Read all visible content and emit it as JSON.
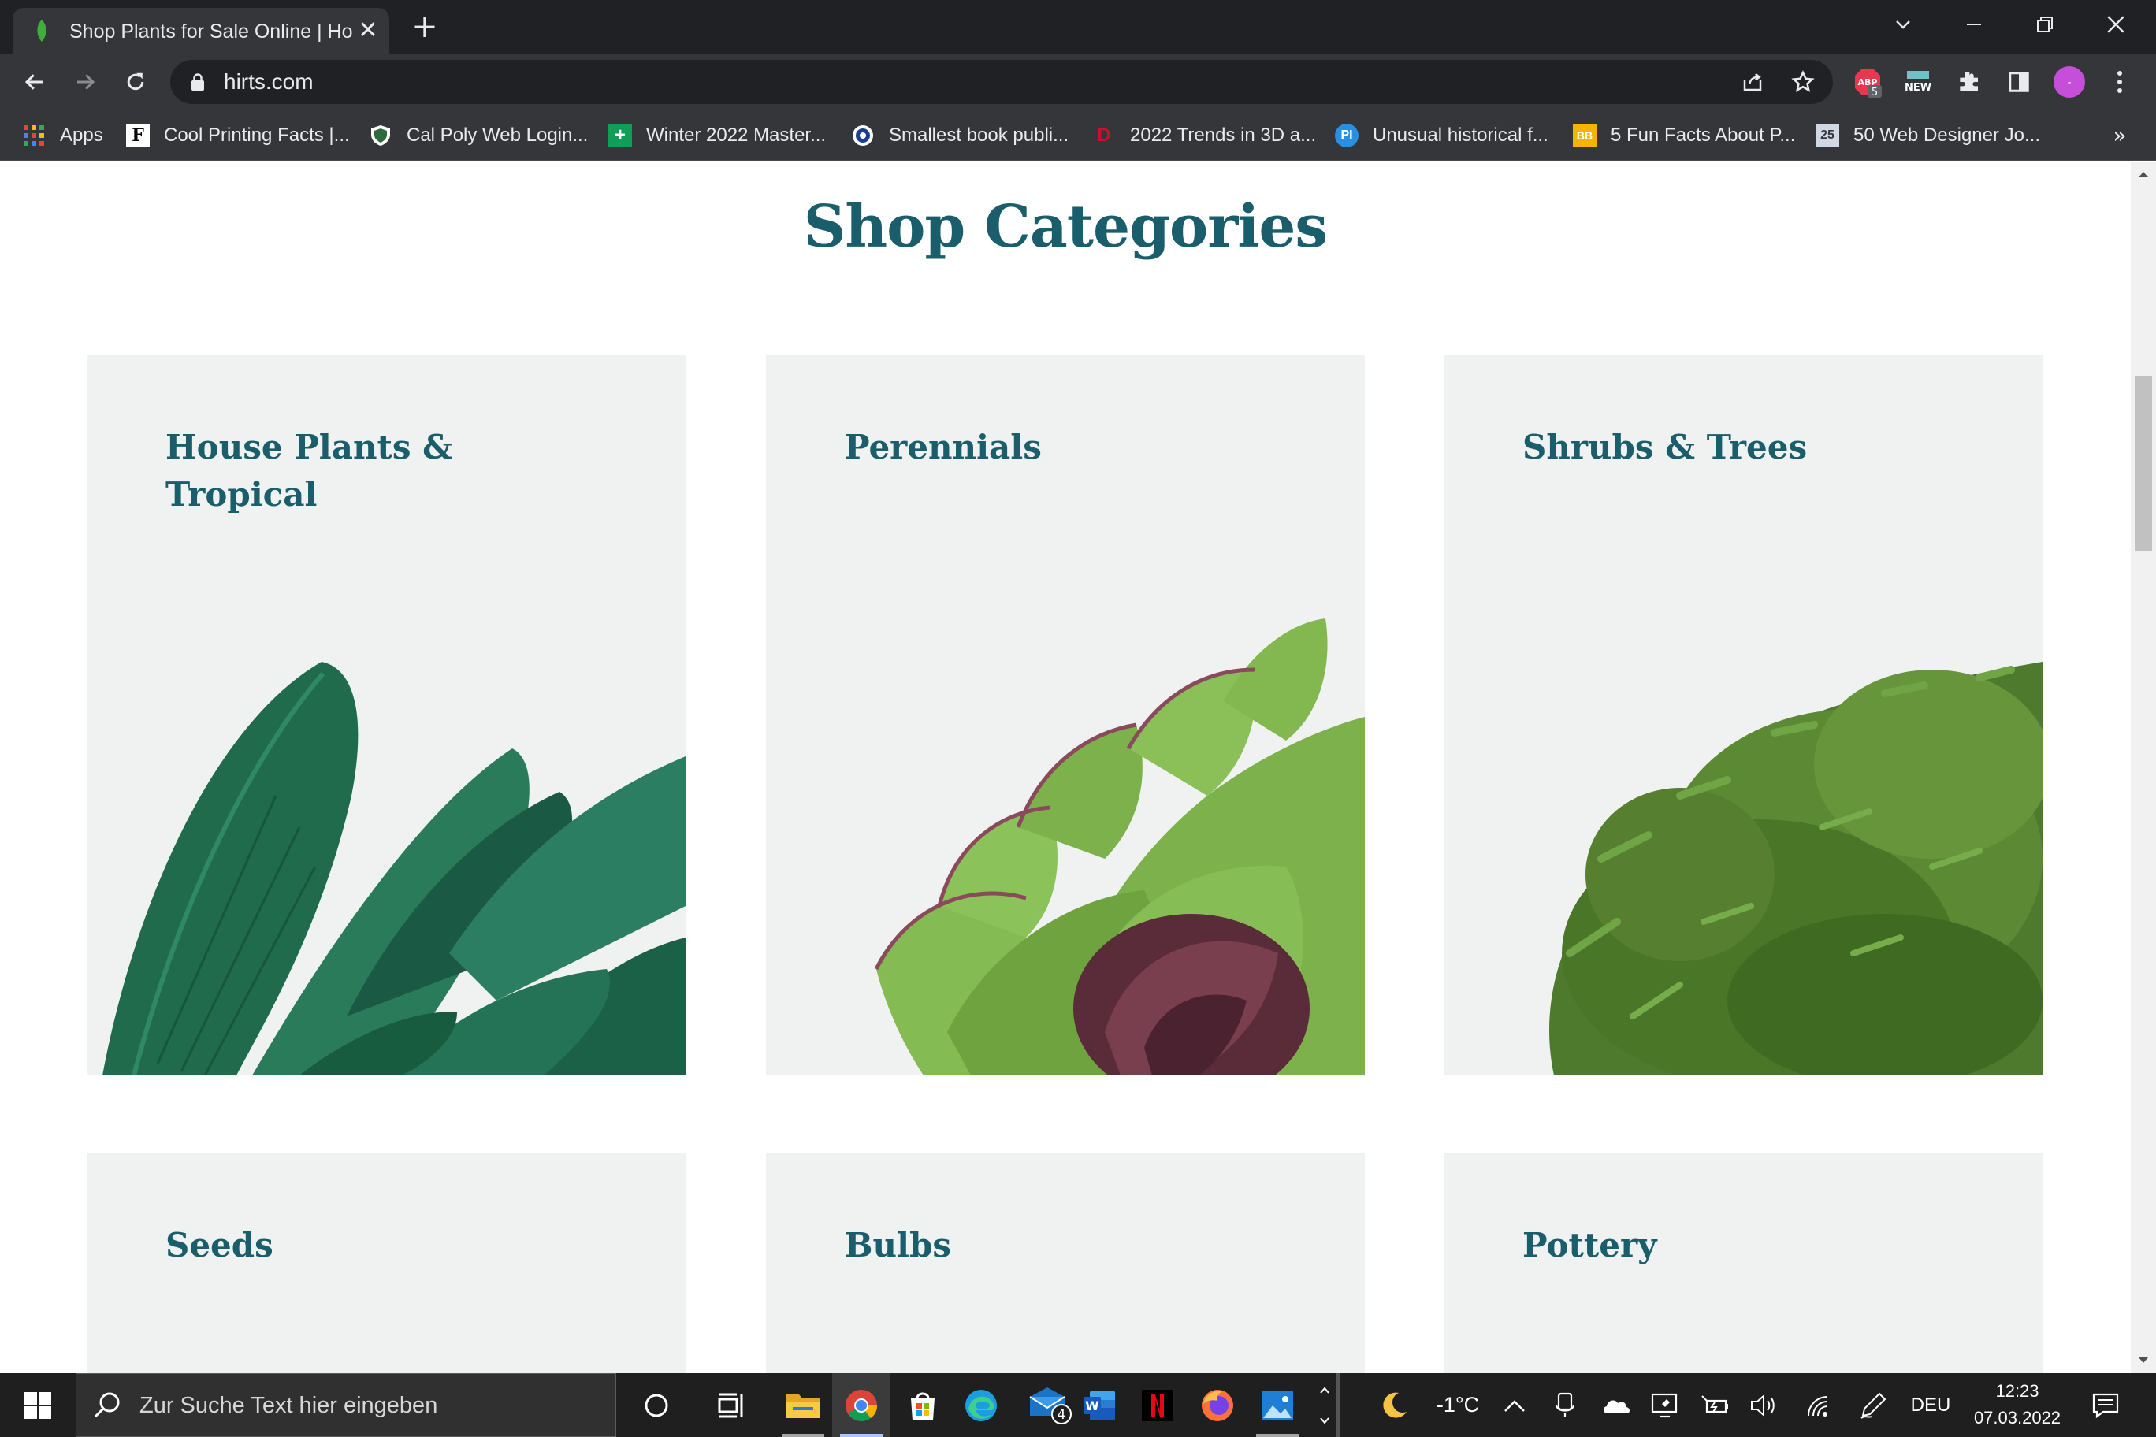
{
  "browser": {
    "tab_title": "Shop Plants for Sale Online | House Plants & Tropical",
    "tab_close": "✕",
    "new_tab": "+",
    "url": "hirts.com",
    "ext_abp_badge": "5",
    "ext_new_label": "NEW",
    "profile_label": "-"
  },
  "bookmarks": {
    "items": [
      {
        "label": "Apps",
        "icon": "apps-grid-icon"
      },
      {
        "label": "Cool Printing Facts |...",
        "icon": "f-icon"
      },
      {
        "label": "Cal Poly Web Login...",
        "icon": "shield-icon"
      },
      {
        "label": "Winter 2022 Master...",
        "icon": "sheets-icon"
      },
      {
        "label": "Smallest book publi...",
        "icon": "guinness-icon"
      },
      {
        "label": "2022 Trends in 3D a...",
        "icon": "d-icon"
      },
      {
        "label": "Unusual historical f...",
        "icon": "pi-icon"
      },
      {
        "label": "5 Fun Facts About P...",
        "icon": "bb-icon"
      },
      {
        "label": "50 Web Designer Jo...",
        "icon": "25-icon"
      }
    ],
    "more": "»"
  },
  "page": {
    "heading": "Shop Categories",
    "categories": [
      {
        "title": "House Plants & Tropical"
      },
      {
        "title": "Perennials"
      },
      {
        "title": "Shrubs & Trees"
      },
      {
        "title": "Seeds"
      },
      {
        "title": "Bulbs"
      },
      {
        "title": "Pottery"
      }
    ]
  },
  "taskbar": {
    "search_placeholder": "Zur Suche Text hier eingeben",
    "mail_badge": "4",
    "weather": "-1°C",
    "language": "DEU",
    "time": "12:23",
    "date": "07.03.2022"
  },
  "colors": {
    "heading": "#1b5e6b",
    "card_bg": "#eff2f1",
    "chrome_dark": "#202124",
    "chrome_toolbar": "#35363a"
  }
}
